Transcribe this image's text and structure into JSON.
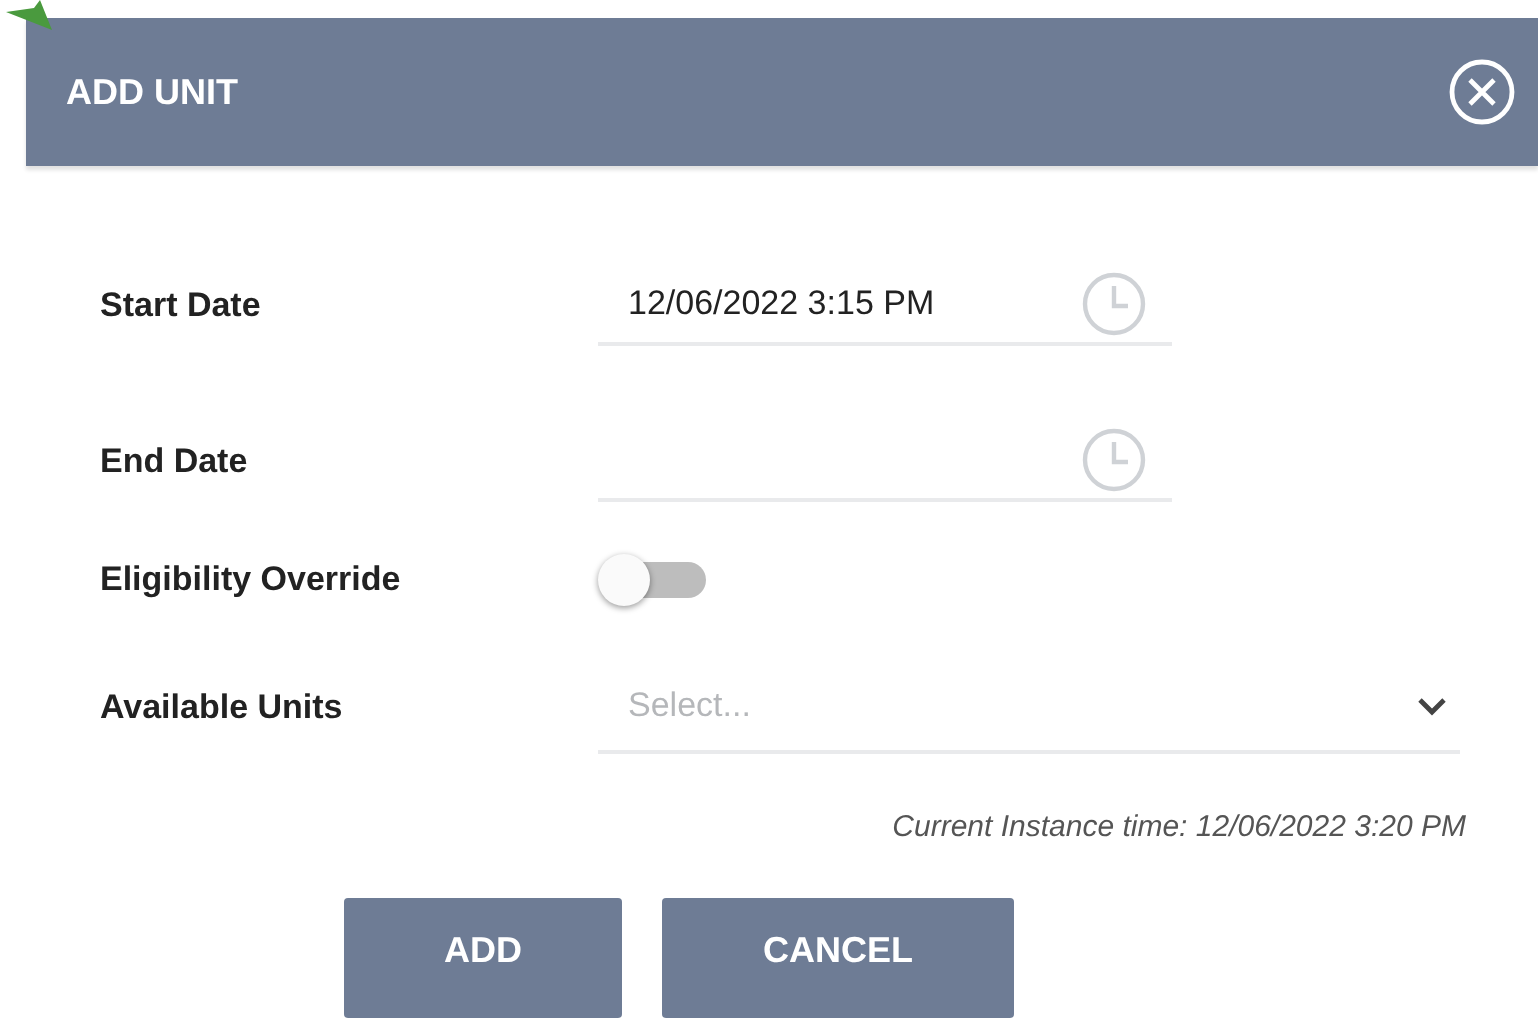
{
  "dialog": {
    "title": "ADD UNIT"
  },
  "fields": [
    {
      "kind": "datetime",
      "label": "Start Date",
      "value": "12/06/2022 3:15 PM"
    },
    {
      "kind": "datetime",
      "label": "End Date"
    },
    {
      "kind": "toggle",
      "label": "Eligibility Override",
      "on": false
    },
    {
      "kind": "select",
      "label": "Available Units",
      "placeholder": "Select..."
    }
  ],
  "note": "Current Instance time: 12/06/2022 3:20 PM",
  "buttons": [
    "ADD",
    "CANCEL"
  ]
}
